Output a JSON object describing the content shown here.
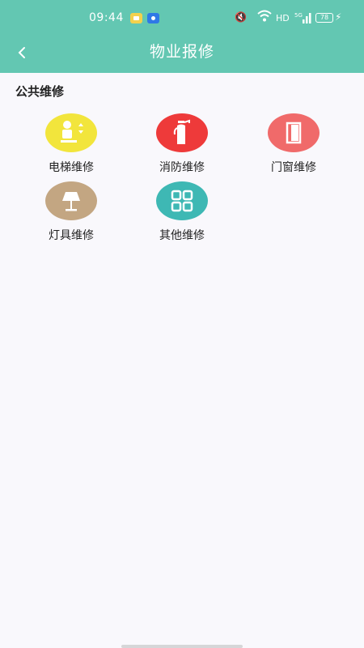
{
  "status_bar": {
    "time": "09:44",
    "network": "HD",
    "signal": "5G",
    "battery": "78"
  },
  "header": {
    "title": "物业报修",
    "color": "#63c7b2"
  },
  "section": {
    "title": "公共维修"
  },
  "items": [
    {
      "label": "电梯维修",
      "icon": "elevator-icon",
      "color": "#f2e53c"
    },
    {
      "label": "消防维修",
      "icon": "fire-extinguisher-icon",
      "color": "#ee3a3a"
    },
    {
      "label": "门窗维修",
      "icon": "door-icon",
      "color": "#f06a6a"
    },
    {
      "label": "灯具维修",
      "icon": "lamp-icon",
      "color": "#c3a682"
    },
    {
      "label": "其他维修",
      "icon": "grid-apps-icon",
      "color": "#3eb8b4"
    }
  ]
}
